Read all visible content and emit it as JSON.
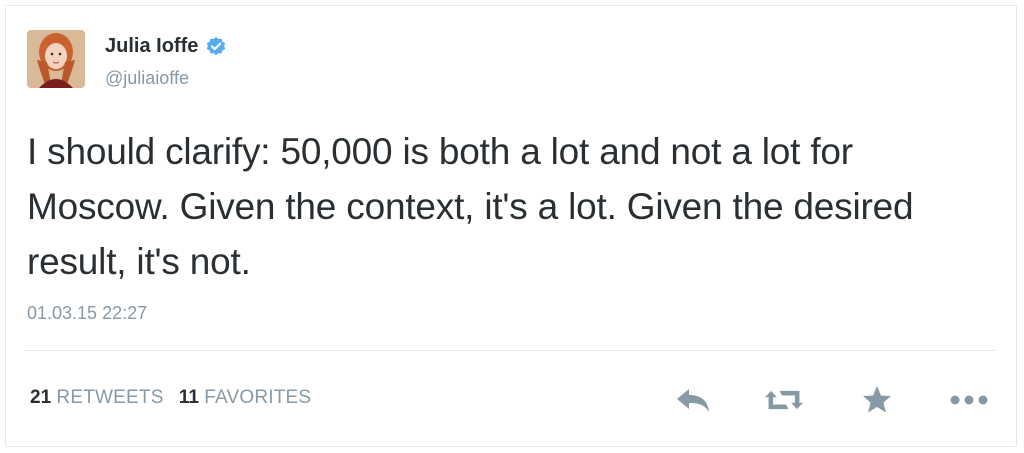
{
  "user": {
    "display_name": "Julia Ioffe",
    "handle": "@juliaioffe",
    "verified_icon": "verified-badge-icon"
  },
  "tweet": {
    "text": "I should clarify: 50,000 is both a lot and not a lot for Moscow. Given the context, it's a lot. Given the desired result, it's not.",
    "timestamp": "01.03.15 22:27"
  },
  "stats": {
    "retweets_count": "21",
    "retweets_label": "RETWEETS",
    "favorites_count": "11",
    "favorites_label": "FAVORITES"
  },
  "actions": {
    "icons": [
      "reply-icon",
      "retweet-icon",
      "favorite-star-icon",
      "more-icon"
    ]
  },
  "colors": {
    "text": "#292f33",
    "muted": "#8899a6",
    "verified": "#55acee",
    "icon_gray": "#8899a6",
    "border": "#e1e8ed"
  }
}
